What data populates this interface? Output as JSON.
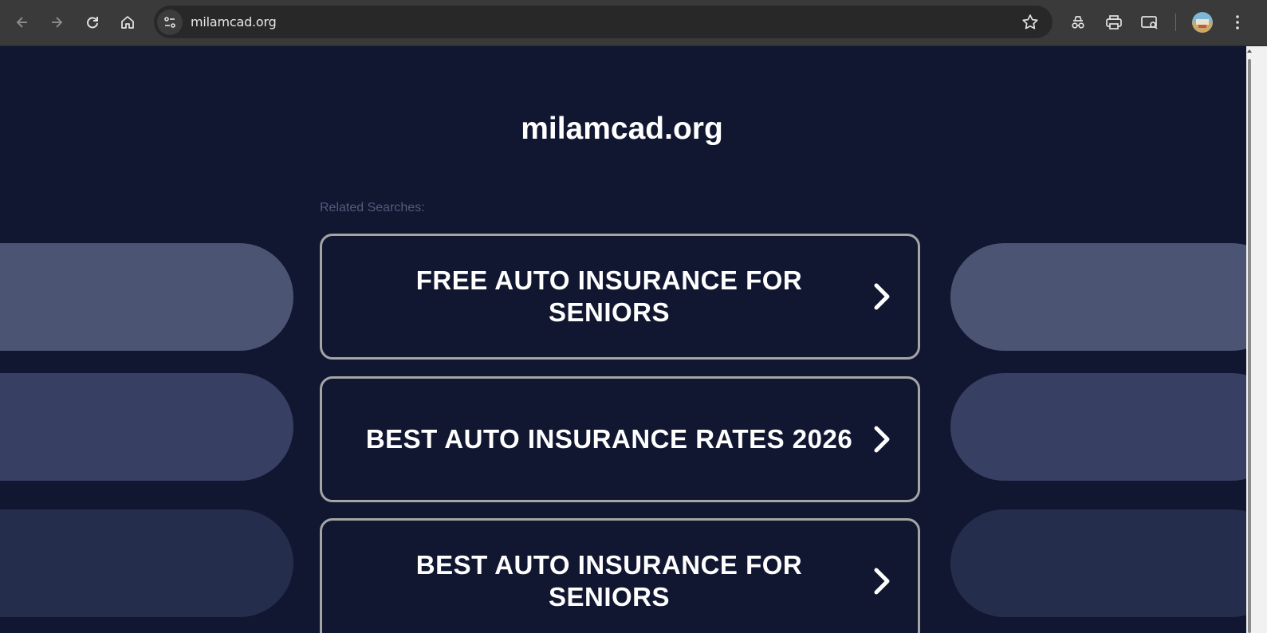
{
  "browser": {
    "url": "milamcad.org",
    "icons": [
      "back-icon",
      "forward-icon",
      "reload-icon",
      "home-icon",
      "site-info-icon",
      "bookmark-star-icon",
      "incognito-icon",
      "print-icon",
      "cast-search-icon",
      "profile-avatar",
      "kebab-menu-icon"
    ]
  },
  "page": {
    "title": "milamcad.org",
    "related_label": "Related Searches:",
    "searches": [
      {
        "label": "FREE AUTO INSURANCE FOR SENIORS"
      },
      {
        "label": "BEST AUTO INSURANCE RATES 2026"
      },
      {
        "label": "BEST AUTO INSURANCE FOR SENIORS"
      }
    ],
    "colors": {
      "background": "#111731",
      "pill_1": "#4b5573",
      "pill_2": "#374062",
      "pill_3": "#252d4d",
      "card_border": "#a5a5a5",
      "label": "#525b7c"
    }
  }
}
